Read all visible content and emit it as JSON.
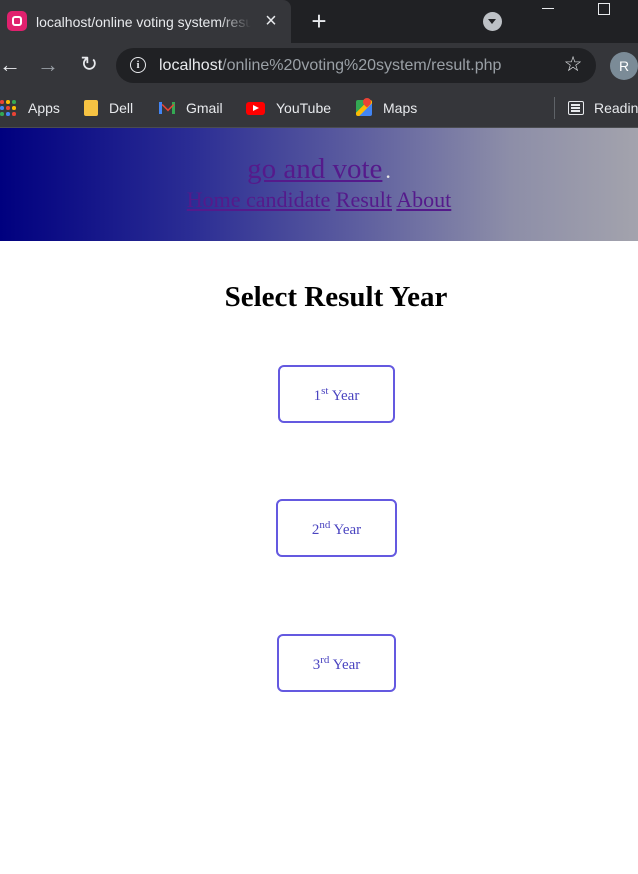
{
  "browser": {
    "tab_title": "localhost/online voting system/result.php",
    "tab_close_glyph": "×",
    "new_tab_glyph": "+",
    "url_host": "localhost",
    "url_path": "/online%20voting%20system/result.php",
    "profile_initial": "R",
    "bookmarks": [
      {
        "label": "Apps",
        "icon": "apps-grid-icon"
      },
      {
        "label": "Dell",
        "icon": "folder-icon"
      },
      {
        "label": "Gmail",
        "icon": "gmail-icon"
      },
      {
        "label": "YouTube",
        "icon": "youtube-icon"
      },
      {
        "label": "Maps",
        "icon": "maps-icon"
      }
    ],
    "reading_list_label": "Reading list"
  },
  "site": {
    "brand": "go and vote",
    "brand_dot": ".",
    "nav": [
      {
        "label": "Home candidate"
      },
      {
        "label": "Result"
      },
      {
        "label": "About"
      }
    ]
  },
  "main": {
    "title": "Select Result Year",
    "years": [
      {
        "number": "1",
        "suffix": "st",
        "word": "Year"
      },
      {
        "number": "2",
        "suffix": "nd",
        "word": "Year"
      },
      {
        "number": "3",
        "suffix": "rd",
        "word": "Year"
      }
    ]
  },
  "colors": {
    "header_gradient_start": "#00007f",
    "header_gradient_end": "#a3a3ad",
    "link_visited": "#551a8b",
    "button_border": "#6459e0",
    "button_text": "#4a44c0"
  }
}
